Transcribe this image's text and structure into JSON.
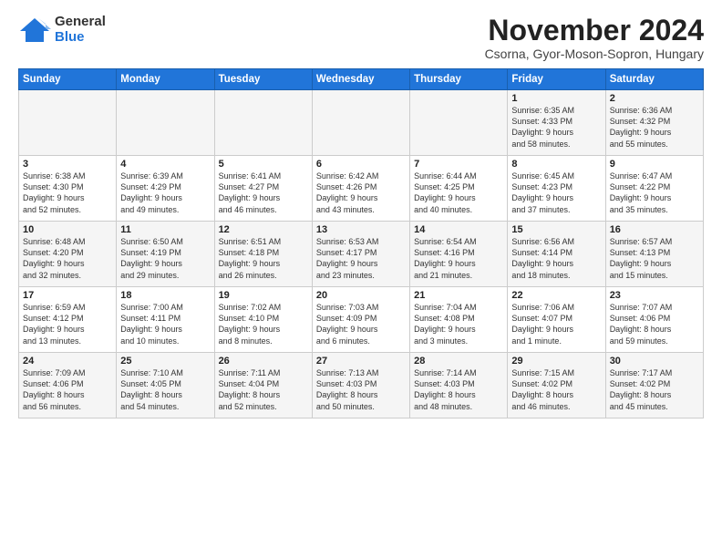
{
  "logo": {
    "general": "General",
    "blue": "Blue"
  },
  "title": "November 2024",
  "location": "Csorna, Gyor-Moson-Sopron, Hungary",
  "days_header": [
    "Sunday",
    "Monday",
    "Tuesday",
    "Wednesday",
    "Thursday",
    "Friday",
    "Saturday"
  ],
  "weeks": [
    [
      {
        "day": "",
        "info": ""
      },
      {
        "day": "",
        "info": ""
      },
      {
        "day": "",
        "info": ""
      },
      {
        "day": "",
        "info": ""
      },
      {
        "day": "",
        "info": ""
      },
      {
        "day": "1",
        "info": "Sunrise: 6:35 AM\nSunset: 4:33 PM\nDaylight: 9 hours\nand 58 minutes."
      },
      {
        "day": "2",
        "info": "Sunrise: 6:36 AM\nSunset: 4:32 PM\nDaylight: 9 hours\nand 55 minutes."
      }
    ],
    [
      {
        "day": "3",
        "info": "Sunrise: 6:38 AM\nSunset: 4:30 PM\nDaylight: 9 hours\nand 52 minutes."
      },
      {
        "day": "4",
        "info": "Sunrise: 6:39 AM\nSunset: 4:29 PM\nDaylight: 9 hours\nand 49 minutes."
      },
      {
        "day": "5",
        "info": "Sunrise: 6:41 AM\nSunset: 4:27 PM\nDaylight: 9 hours\nand 46 minutes."
      },
      {
        "day": "6",
        "info": "Sunrise: 6:42 AM\nSunset: 4:26 PM\nDaylight: 9 hours\nand 43 minutes."
      },
      {
        "day": "7",
        "info": "Sunrise: 6:44 AM\nSunset: 4:25 PM\nDaylight: 9 hours\nand 40 minutes."
      },
      {
        "day": "8",
        "info": "Sunrise: 6:45 AM\nSunset: 4:23 PM\nDaylight: 9 hours\nand 37 minutes."
      },
      {
        "day": "9",
        "info": "Sunrise: 6:47 AM\nSunset: 4:22 PM\nDaylight: 9 hours\nand 35 minutes."
      }
    ],
    [
      {
        "day": "10",
        "info": "Sunrise: 6:48 AM\nSunset: 4:20 PM\nDaylight: 9 hours\nand 32 minutes."
      },
      {
        "day": "11",
        "info": "Sunrise: 6:50 AM\nSunset: 4:19 PM\nDaylight: 9 hours\nand 29 minutes."
      },
      {
        "day": "12",
        "info": "Sunrise: 6:51 AM\nSunset: 4:18 PM\nDaylight: 9 hours\nand 26 minutes."
      },
      {
        "day": "13",
        "info": "Sunrise: 6:53 AM\nSunset: 4:17 PM\nDaylight: 9 hours\nand 23 minutes."
      },
      {
        "day": "14",
        "info": "Sunrise: 6:54 AM\nSunset: 4:16 PM\nDaylight: 9 hours\nand 21 minutes."
      },
      {
        "day": "15",
        "info": "Sunrise: 6:56 AM\nSunset: 4:14 PM\nDaylight: 9 hours\nand 18 minutes."
      },
      {
        "day": "16",
        "info": "Sunrise: 6:57 AM\nSunset: 4:13 PM\nDaylight: 9 hours\nand 15 minutes."
      }
    ],
    [
      {
        "day": "17",
        "info": "Sunrise: 6:59 AM\nSunset: 4:12 PM\nDaylight: 9 hours\nand 13 minutes."
      },
      {
        "day": "18",
        "info": "Sunrise: 7:00 AM\nSunset: 4:11 PM\nDaylight: 9 hours\nand 10 minutes."
      },
      {
        "day": "19",
        "info": "Sunrise: 7:02 AM\nSunset: 4:10 PM\nDaylight: 9 hours\nand 8 minutes."
      },
      {
        "day": "20",
        "info": "Sunrise: 7:03 AM\nSunset: 4:09 PM\nDaylight: 9 hours\nand 6 minutes."
      },
      {
        "day": "21",
        "info": "Sunrise: 7:04 AM\nSunset: 4:08 PM\nDaylight: 9 hours\nand 3 minutes."
      },
      {
        "day": "22",
        "info": "Sunrise: 7:06 AM\nSunset: 4:07 PM\nDaylight: 9 hours\nand 1 minute."
      },
      {
        "day": "23",
        "info": "Sunrise: 7:07 AM\nSunset: 4:06 PM\nDaylight: 8 hours\nand 59 minutes."
      }
    ],
    [
      {
        "day": "24",
        "info": "Sunrise: 7:09 AM\nSunset: 4:06 PM\nDaylight: 8 hours\nand 56 minutes."
      },
      {
        "day": "25",
        "info": "Sunrise: 7:10 AM\nSunset: 4:05 PM\nDaylight: 8 hours\nand 54 minutes."
      },
      {
        "day": "26",
        "info": "Sunrise: 7:11 AM\nSunset: 4:04 PM\nDaylight: 8 hours\nand 52 minutes."
      },
      {
        "day": "27",
        "info": "Sunrise: 7:13 AM\nSunset: 4:03 PM\nDaylight: 8 hours\nand 50 minutes."
      },
      {
        "day": "28",
        "info": "Sunrise: 7:14 AM\nSunset: 4:03 PM\nDaylight: 8 hours\nand 48 minutes."
      },
      {
        "day": "29",
        "info": "Sunrise: 7:15 AM\nSunset: 4:02 PM\nDaylight: 8 hours\nand 46 minutes."
      },
      {
        "day": "30",
        "info": "Sunrise: 7:17 AM\nSunset: 4:02 PM\nDaylight: 8 hours\nand 45 minutes."
      }
    ]
  ]
}
